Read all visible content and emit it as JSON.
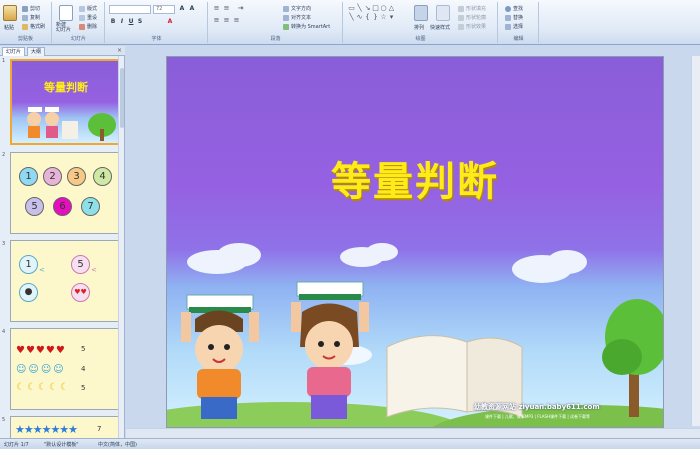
{
  "ribbon": {
    "clipboard": {
      "paste": "粘贴",
      "cut": "剪切",
      "copy": "复制",
      "format_painter": "格式刷",
      "group_label": "剪贴板"
    },
    "slides": {
      "new_slide": "新建\n幻灯片",
      "layout": "版式",
      "reset": "重设",
      "delete": "删除",
      "group_label": "幻灯片"
    },
    "font": {
      "font_size": "72",
      "bold": "B",
      "italic": "I",
      "underline": "U",
      "strike": "S",
      "group_label": "字体"
    },
    "paragraph": {
      "text_direction": "文字方向",
      "align_text": "对齐文本",
      "convert_smartart": "转换为 SmartArt",
      "group_label": "段落"
    },
    "drawing": {
      "arrange": "排列",
      "quick_styles": "快速样式",
      "shape_fill": "形状填充",
      "shape_outline": "形状轮廓",
      "shape_effects": "形状效果",
      "group_label": "绘图"
    },
    "editing": {
      "find": "查找",
      "replace": "替换",
      "select": "选择",
      "group_label": "编辑"
    }
  },
  "panel": {
    "tab_slides": "幻灯片",
    "tab_outline": "大纲",
    "close": "×"
  },
  "thumbnails": {
    "slide1": {
      "num": "1",
      "title": "等量判断"
    },
    "slide2": {
      "num": "2",
      "circles": [
        "1",
        "2",
        "3",
        "4",
        "5",
        "6",
        "7"
      ]
    },
    "slide3": {
      "num": "3",
      "a": "1",
      "b": "5"
    },
    "slide4": {
      "num": "4",
      "counts": [
        "5",
        "4",
        "5"
      ]
    },
    "slide5": {
      "num": "5",
      "count": "7"
    }
  },
  "slide": {
    "title": "等量判断",
    "site_name": "幼教资源网站",
    "site_url": "ziyuan.baby611.com",
    "site_links": "课件下载 | 儿歌、故事MP3 | FLASH课件下载 | 试卷下载等"
  },
  "status": {
    "slide_info": "幻灯片 1/7",
    "theme": "\"默认设计模板\"",
    "language": "中文(简体，中国)"
  }
}
